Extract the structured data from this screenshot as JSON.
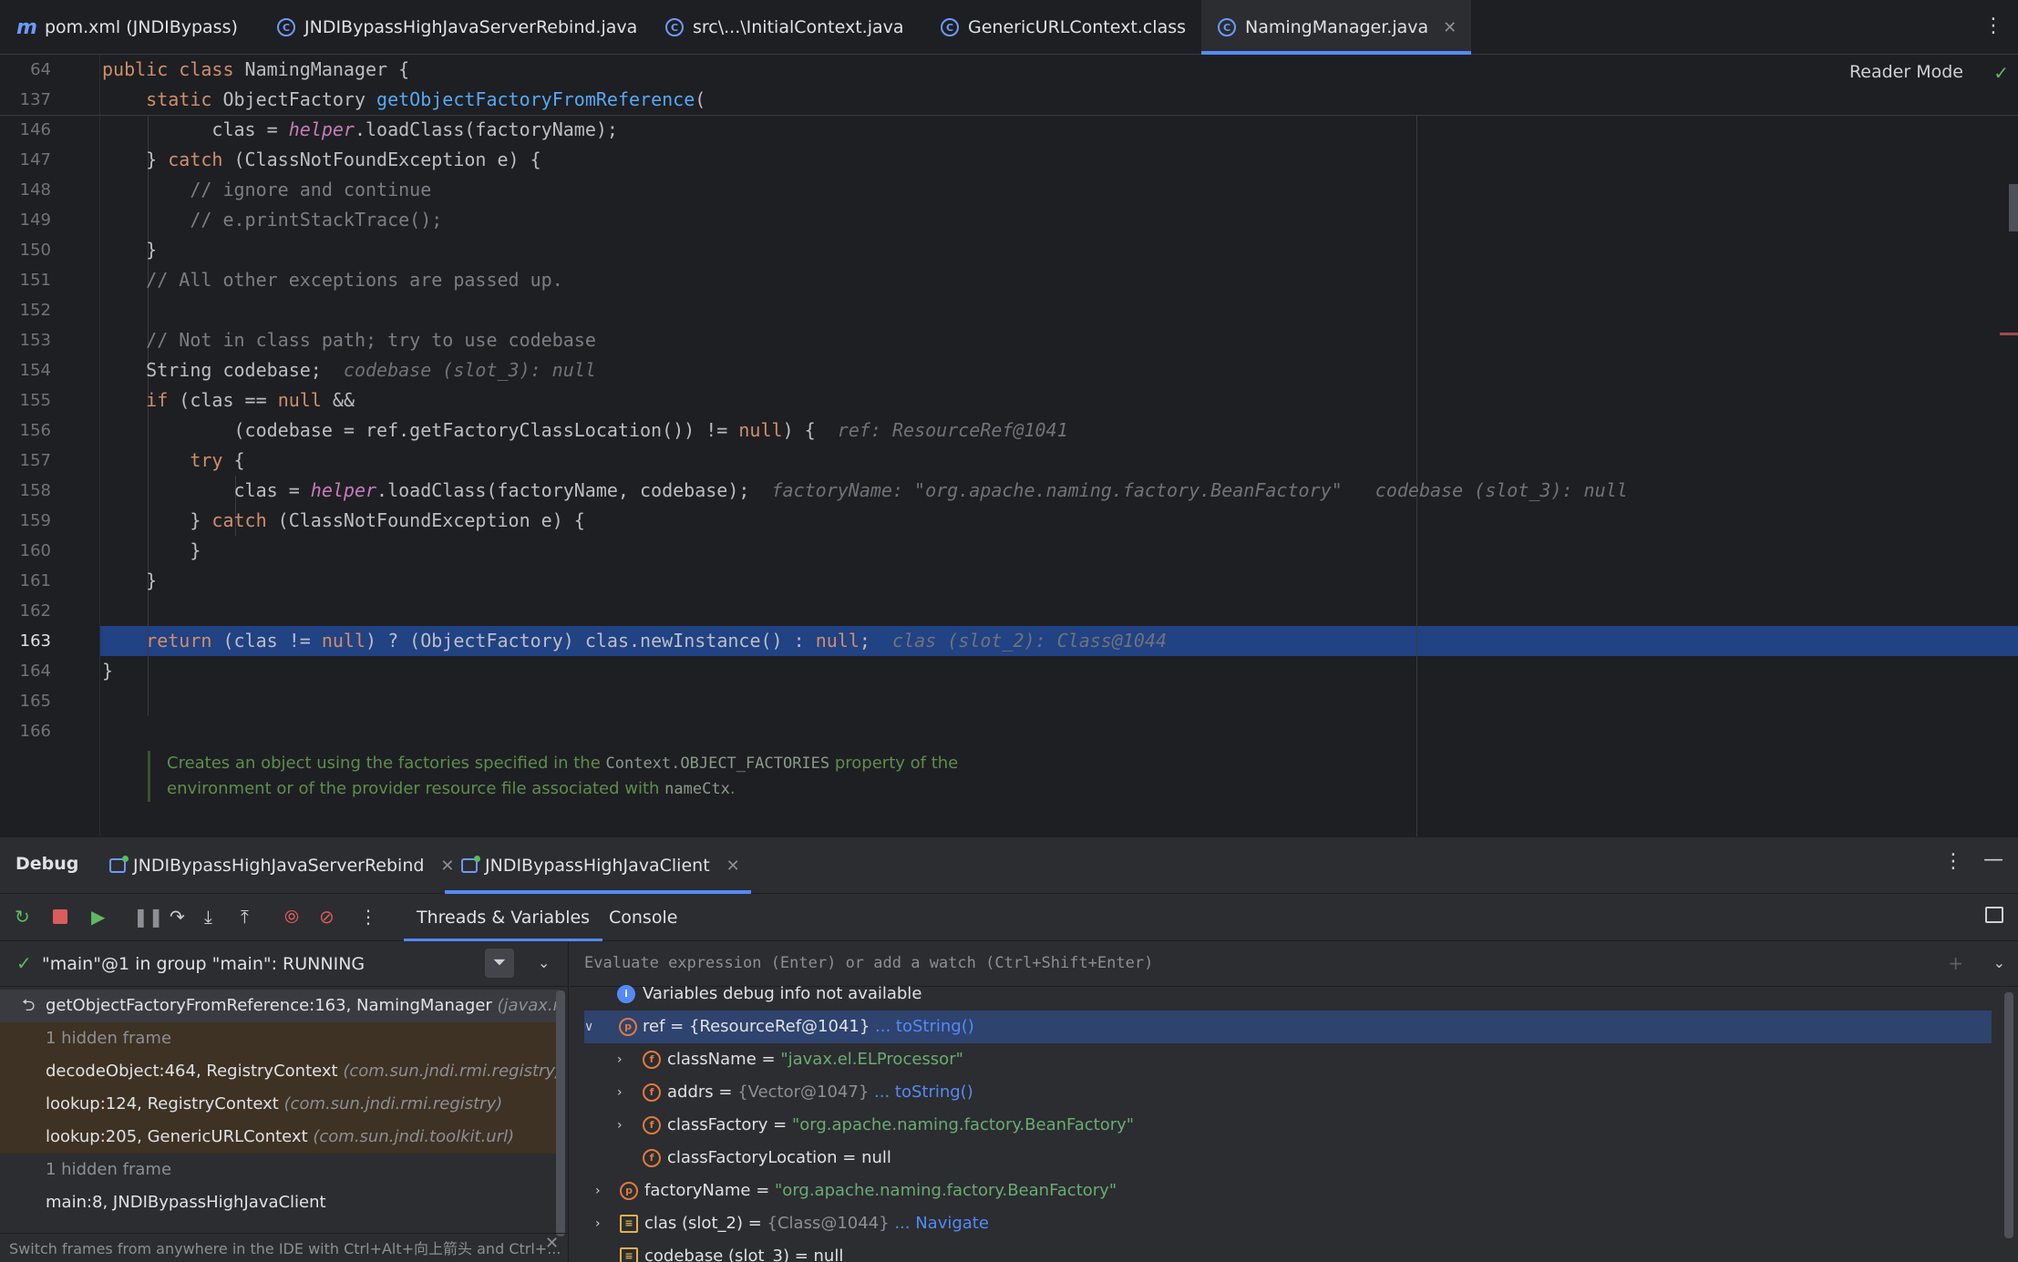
{
  "tabs": [
    {
      "label": "pom.xml (JNDIBypass)",
      "icon": "maven-icon"
    },
    {
      "label": "JNDIBypassHighJavaServerRebind.java",
      "icon": "class-icon"
    },
    {
      "label": "src\\...\\InitialContext.java",
      "icon": "class-icon"
    },
    {
      "label": "GenericURLContext.class",
      "icon": "class-icon"
    },
    {
      "label": "NamingManager.java",
      "icon": "class-icon",
      "active": true
    }
  ],
  "editor": {
    "reader_mode": "Reader Mode",
    "sticky_lines": [
      {
        "num": "64",
        "code": "public class NamingManager {"
      },
      {
        "num": "137",
        "code": "    static ObjectFactory getObjectFactoryFromReference("
      }
    ],
    "line_numbers": [
      "146",
      "147",
      "148",
      "149",
      "150",
      "151",
      "152",
      "153",
      "154",
      "155",
      "156",
      "157",
      "158",
      "159",
      "160",
      "161",
      "162",
      "163",
      "164",
      "165",
      "166"
    ],
    "current_line": "163",
    "inline_hints": {
      "h154": "codebase (slot_3): null",
      "h156": "ref: ResourceRef@1041",
      "h158a": "factoryName: \"org.apache.naming.factory.BeanFactory\"",
      "h158b": "codebase (slot_3): null",
      "h163": "clas (slot_2): Class@1044"
    },
    "doc_comment": {
      "part1": "Creates an object using the factories specified in the ",
      "code1": "Context.OBJECT_FACTORIES",
      "part2": " property of the",
      "part3": "environment or of the provider resource file associated with ",
      "code2": "nameCtx",
      "part4": "."
    }
  },
  "debug": {
    "title": "Debug",
    "sessions": [
      {
        "label": "JNDIBypassHighJavaServerRebind"
      },
      {
        "label": "JNDIBypassHighJavaClient",
        "active": true
      }
    ],
    "subtabs": [
      "Threads & Variables",
      "Console"
    ],
    "thread": "\"main\"@1 in group \"main\": RUNNING",
    "frames": [
      {
        "method": "getObjectFactoryFromReference:163, NamingManager",
        "pkg": "(javax.naming.spi)",
        "state": "selected"
      },
      {
        "method": "1 hidden frame",
        "pkg": "",
        "state": "hidden-lib"
      },
      {
        "method": "decodeObject:464, RegistryContext",
        "pkg": "(com.sun.jndi.rmi.registry)",
        "state": "lib"
      },
      {
        "method": "lookup:124, RegistryContext",
        "pkg": "(com.sun.jndi.rmi.registry)",
        "state": "lib"
      },
      {
        "method": "lookup:205, GenericURLContext",
        "pkg": "(com.sun.jndi.toolkit.url)",
        "state": "lib"
      },
      {
        "method": "1 hidden frame",
        "pkg": "",
        "state": "hidden"
      },
      {
        "method": "main:8, JNDIBypassHighJavaClient",
        "pkg": "",
        "state": "normal"
      }
    ],
    "hint": "Switch frames from anywhere in the IDE with Ctrl+Alt+向上箭头 and Ctrl+...",
    "eval_placeholder": "Evaluate expression (Enter) or add a watch (Ctrl+Shift+Enter)",
    "variables": {
      "info": "Variables debug info not available",
      "ref_name": "ref",
      "ref_value": " = {ResourceRef@1041}",
      "ref_link": " ... toString()",
      "className_name": "className",
      "className_value": "\"javax.el.ELProcessor\"",
      "addrs_name": "addrs",
      "addrs_value": "{Vector@1047}",
      "addrs_link": " ... toString()",
      "classFactory_name": "classFactory",
      "classFactory_value": "\"org.apache.naming.factory.BeanFactory\"",
      "classFactoryLocation_name": "classFactoryLocation",
      "classFactoryLocation_value": " = null",
      "factoryName_name": "factoryName",
      "factoryName_value": "\"org.apache.naming.factory.BeanFactory\"",
      "clas_name": "clas (slot_2)",
      "clas_value": "{Class@1044}",
      "clas_link": " ... Navigate",
      "codebase_name": "codebase (slot_3)",
      "codebase_value": " = null"
    }
  },
  "colors": {
    "accent": "#548af7",
    "highlight_line": "#214283",
    "keyword": "#cf8e6d",
    "string": "#6aab73",
    "comment": "#7a7e85"
  }
}
